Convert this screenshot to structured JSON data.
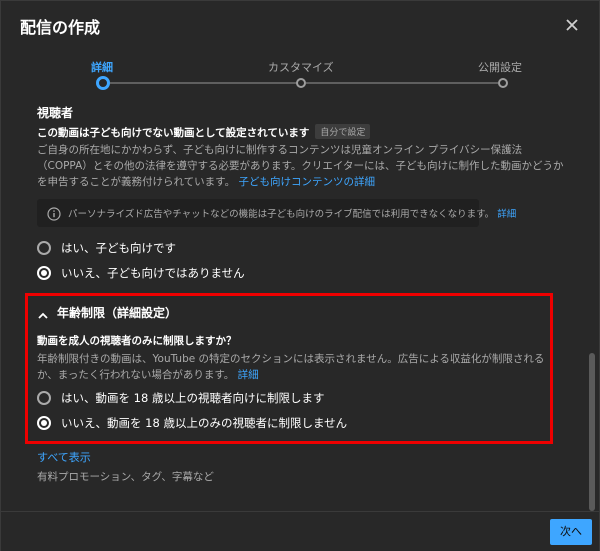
{
  "dialog": {
    "title": "配信の作成",
    "close_icon": "close-icon"
  },
  "stepper": {
    "steps": [
      {
        "label": "詳細",
        "active": true
      },
      {
        "label": "カスタマイズ",
        "active": false
      },
      {
        "label": "公開設定",
        "active": false
      }
    ],
    "accent_color": "#3ea6ff"
  },
  "audience": {
    "heading": "視聴者",
    "status_text": "この動画は子ども向けでない動画として設定されています",
    "status_badge": "自分で設定",
    "description": "ご自身の所在地にかかわらず、子ども向けに制作するコンテンツは児童オンライン プライバシー保護法（COPPA）とその他の法律を遵守する必要があります。クリエイターには、子ども向けに制作した動画かどうかを申告することが義務付けられています。",
    "description_link": "子ども向けコンテンツの詳細",
    "info_text": "パーソナライズド広告やチャットなどの機能は子ども向けのライブ配信では利用できなくなります。",
    "info_link": "詳細",
    "options": [
      {
        "label": "はい、子ども向けです",
        "checked": false
      },
      {
        "label": "いいえ、子ども向けではありません",
        "checked": true
      }
    ]
  },
  "age_restriction": {
    "toggle_label": "年齢制限（詳細設定）",
    "question": "動画を成人の視聴者のみに制限しますか？",
    "description": "年齢制限付きの動画は、YouTube の特定のセクションには表示されません。広告による収益化が制限されるか、まったく行われない場合があります。",
    "description_link": "詳細",
    "options": [
      {
        "label": "はい、動画を 18 歳以上の視聴者向けに制限します",
        "checked": false
      },
      {
        "label": "いいえ、動画を 18 歳以上のみの視聴者に制限しません",
        "checked": true
      }
    ],
    "highlight_color": "#ee0000"
  },
  "show_all": {
    "link": "すべて表示",
    "description": "有料プロモーション、タグ、字幕など"
  },
  "footer": {
    "next_label": "次へ"
  }
}
